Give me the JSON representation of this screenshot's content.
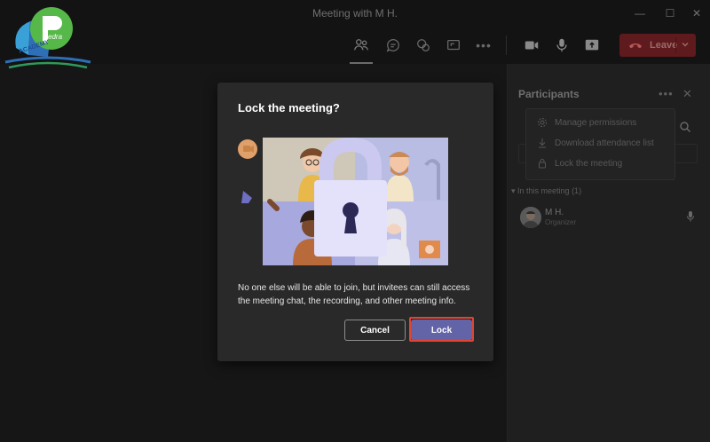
{
  "window": {
    "title": "Meeting with M H."
  },
  "toolbar": {
    "leave_label": "Leave"
  },
  "participants": {
    "title": "Participants",
    "section_label": "In this meeting (1)",
    "items": [
      {
        "name": "M H.",
        "role": "Organizer"
      }
    ]
  },
  "more_menu": {
    "items": [
      {
        "label": "Manage permissions",
        "icon": "gear-icon"
      },
      {
        "label": "Download attendance list",
        "icon": "download-icon"
      },
      {
        "label": "Lock the meeting",
        "icon": "lock-icon"
      }
    ]
  },
  "dialog": {
    "title": "Lock the meeting?",
    "body": "No one else will be able to join, but invitees can still access the meeting chat, the recording, and other meeting info.",
    "cancel_label": "Cancel",
    "lock_label": "Lock"
  },
  "logo": {
    "brand": "edra",
    "text": "ACADEMY"
  },
  "colors": {
    "accent": "#6264a7",
    "leave": "#5e1a1d",
    "highlight": "#e5432f"
  }
}
